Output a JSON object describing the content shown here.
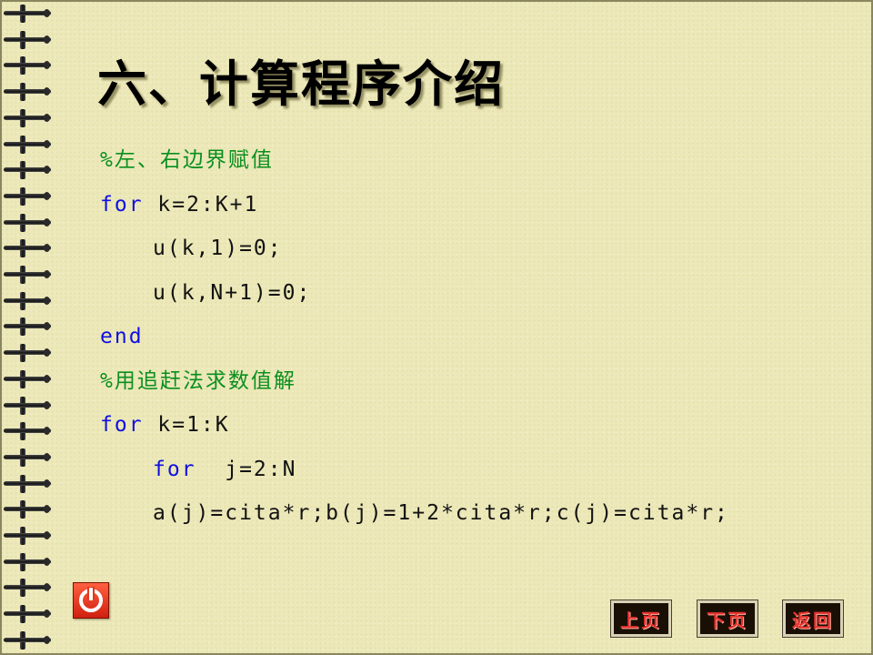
{
  "slide": {
    "title": "六、计算程序介绍",
    "code_lines": [
      {
        "parts": [
          {
            "type": "comment",
            "text": "%左、右边界赋值"
          }
        ],
        "indent": 0
      },
      {
        "parts": [
          {
            "type": "kw",
            "text": "for"
          },
          {
            "type": "txt",
            "text": " k=2:K+1"
          }
        ],
        "indent": 0
      },
      {
        "parts": [
          {
            "type": "txt",
            "text": "u(k,1)=0;"
          }
        ],
        "indent": 1
      },
      {
        "parts": [
          {
            "type": "txt",
            "text": "u(k,N+1)=0;"
          }
        ],
        "indent": 1
      },
      {
        "parts": [
          {
            "type": "kw",
            "text": "end"
          }
        ],
        "indent": 0
      },
      {
        "parts": [
          {
            "type": "comment",
            "text": "%用追赶法求数值解"
          }
        ],
        "indent": 0
      },
      {
        "parts": [
          {
            "type": "kw",
            "text": "for"
          },
          {
            "type": "txt",
            "text": " k=1:K"
          }
        ],
        "indent": 0
      },
      {
        "parts": [
          {
            "type": "kw",
            "text": "for"
          },
          {
            "type": "txt",
            "text": "  j=2:N"
          }
        ],
        "indent": 1
      },
      {
        "parts": [
          {
            "type": "txt",
            "text": "a(j)=cita*r;b(j)=1+2*cita*r;c(j)=cita*r;"
          }
        ],
        "indent": 1
      }
    ]
  },
  "navigation": {
    "power_icon": "power-icon",
    "prev_label": "上页",
    "next_label": "下页",
    "back_label": "返回"
  },
  "colors": {
    "background": "#ece8b8",
    "comment": "#0a8f1e",
    "keyword": "#1010e0",
    "nav_text": "#e6322e",
    "power_button": "#e03a1e"
  }
}
